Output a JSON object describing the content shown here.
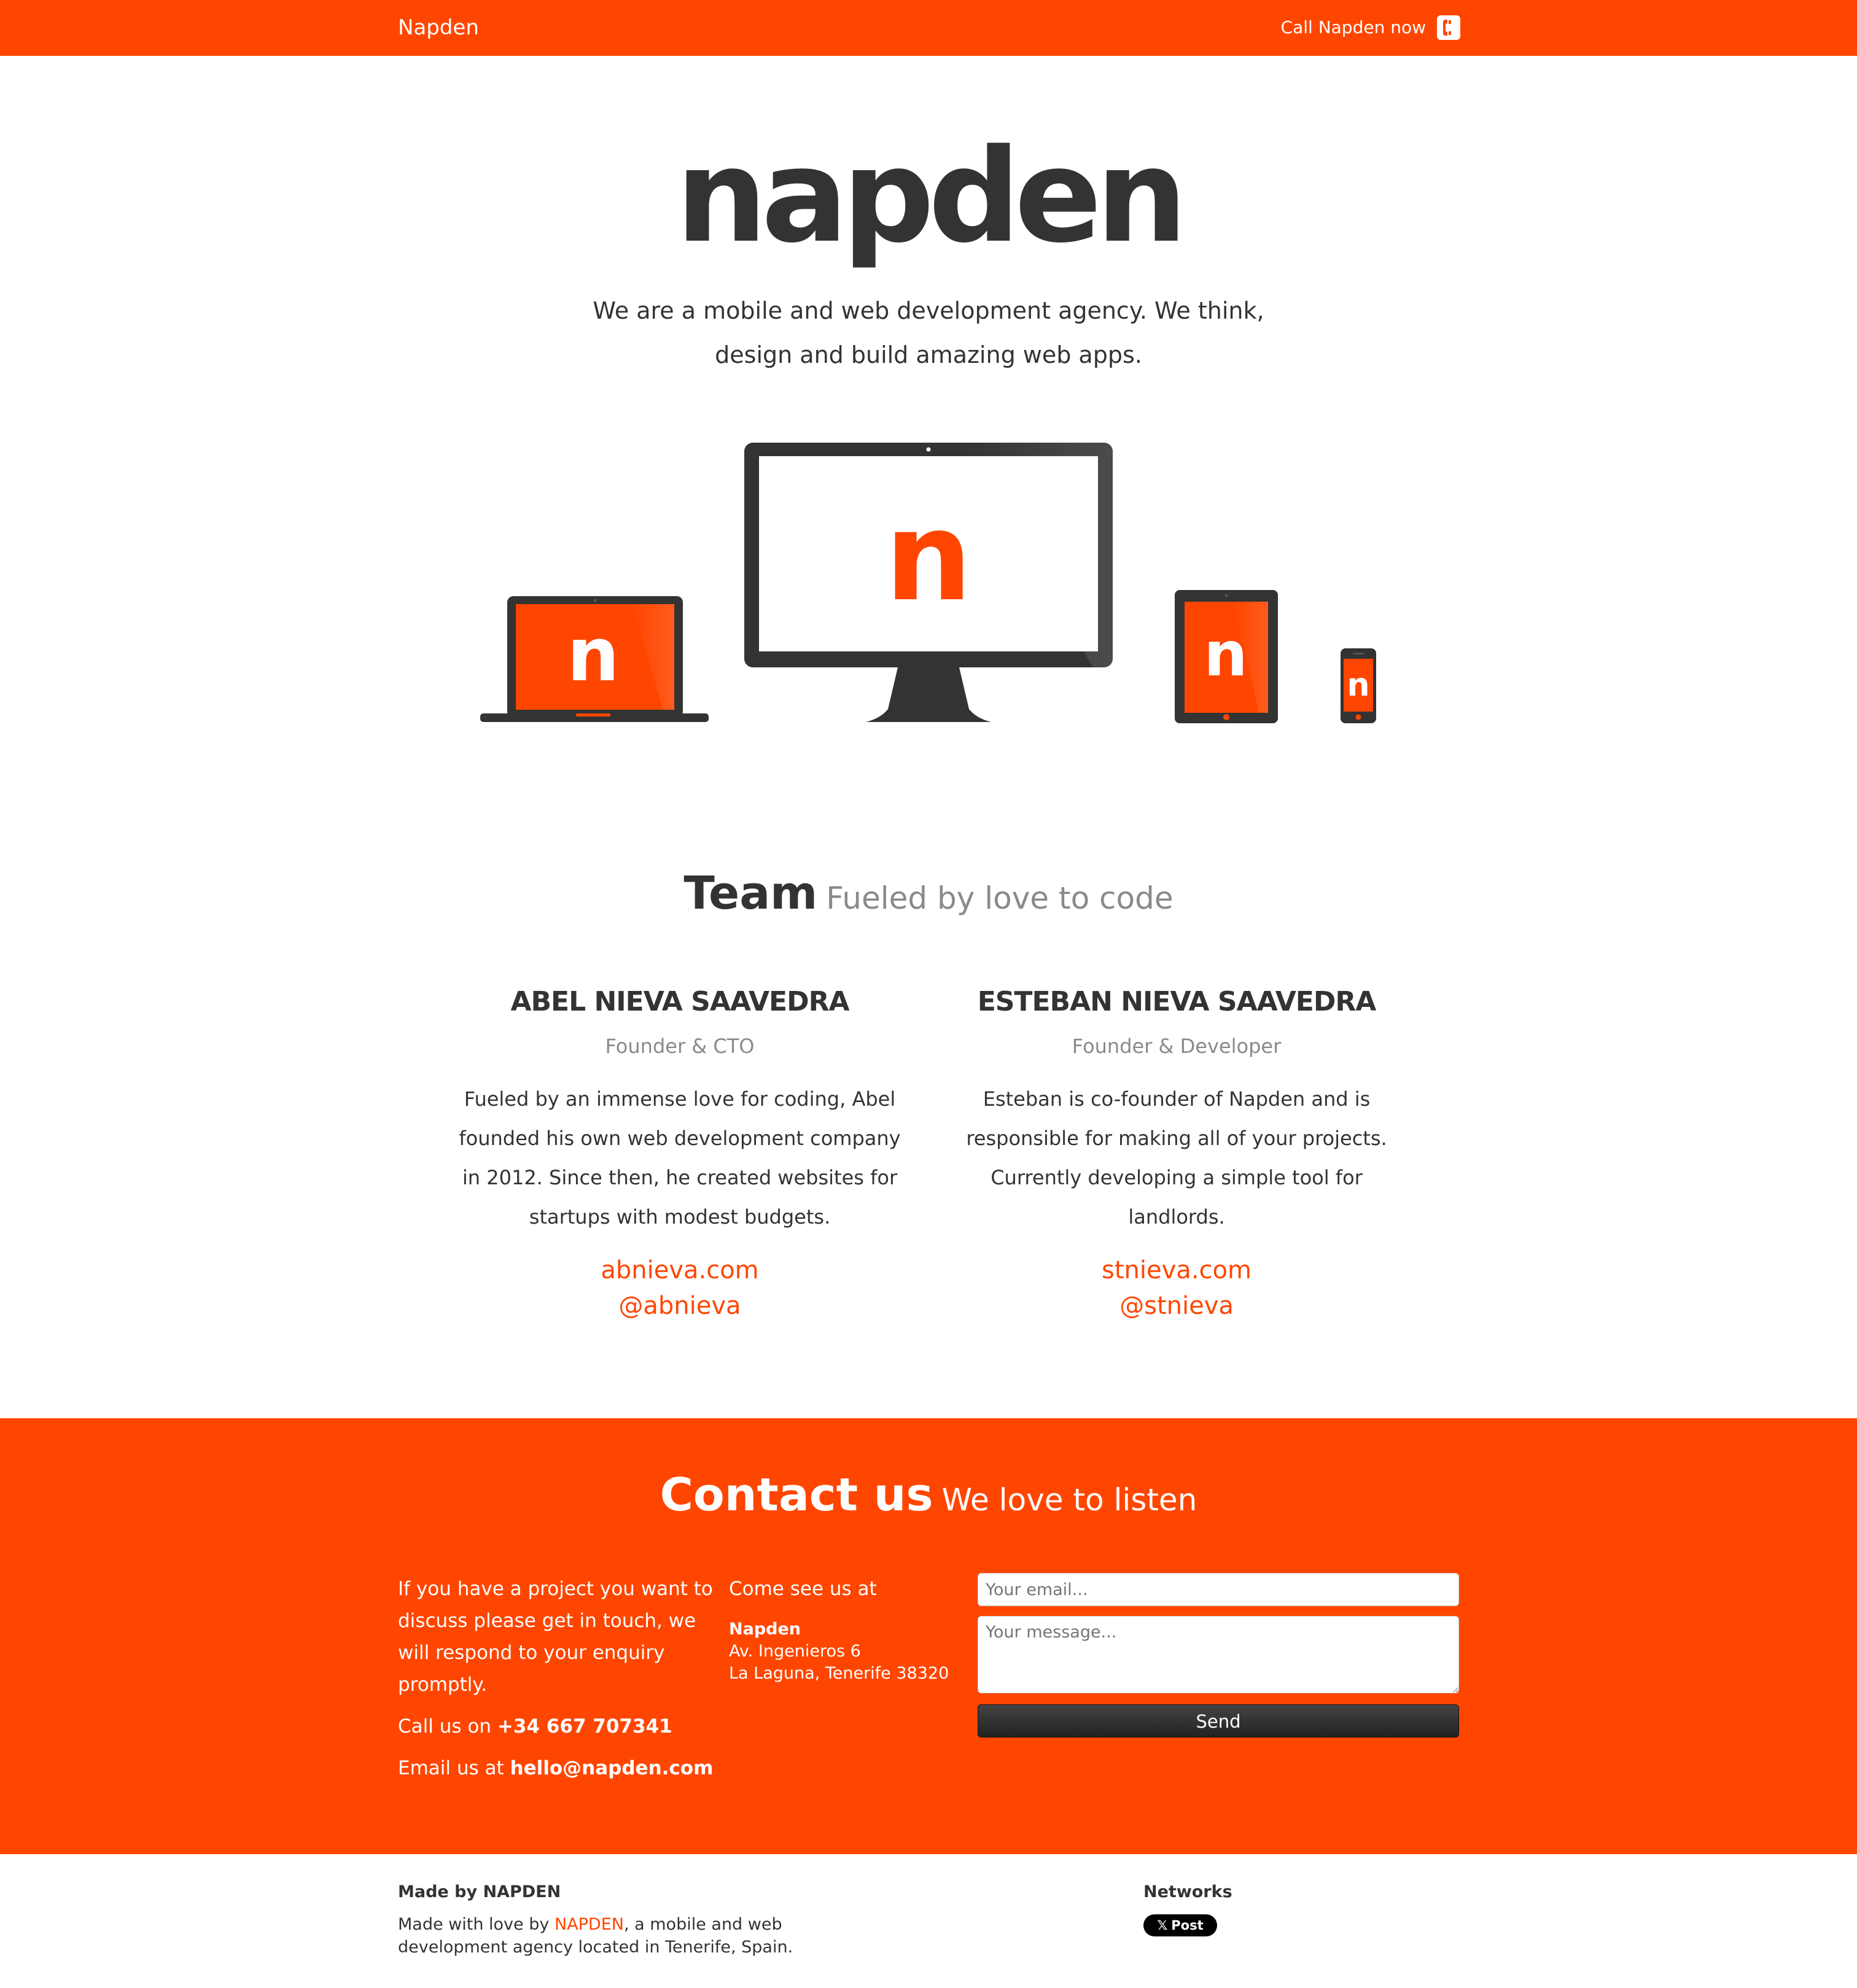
{
  "header": {
    "brand": "Napden",
    "call_label": "Call Napden now",
    "call_icon": "phone-icon"
  },
  "hero": {
    "logo_text": "napden",
    "tagline": "We are a mobile and web development agency. We think, design and build amazing web apps.",
    "device_screen_letter": "n"
  },
  "team": {
    "title": "Team",
    "subtitle": "Fueled by love to code",
    "members": [
      {
        "name": "ABEL NIEVA SAAVEDRA",
        "role": "Founder & CTO",
        "bio": "Fueled by an immense love for coding, Abel founded his own web development company in 2012. Since then, he created websites for startups with modest budgets.",
        "website": "abnieva.com",
        "handle": "@abnieva"
      },
      {
        "name": "ESTEBAN NIEVA SAAVEDRA",
        "role": "Founder & Developer",
        "bio": "Esteban is co-founder of Napden and is responsible for making all of your projects. Currently developing a simple tool for landlords.",
        "website": "stnieva.com",
        "handle": "@stnieva"
      }
    ]
  },
  "contact": {
    "title": "Contact us",
    "subtitle": "We love to listen",
    "intro": "If you have a project you want to discuss please get in touch, we will respond to your enquiry promptly.",
    "call_prefix": "Call us on",
    "phone": "+34 667 707341",
    "email_prefix": "Email us at",
    "email": "hello@napden.com",
    "visit_label": "Come see us at",
    "address_name": "Napden",
    "address_line1": "Av. Ingenieros 6",
    "address_line2": "La Laguna, Tenerife 38320",
    "email_placeholder": "Your email...",
    "message_placeholder": "Your message...",
    "send_label": "Send"
  },
  "footer": {
    "made_by_heading": "Made by NAPDEN",
    "made_with_prefix": "Made with love by",
    "made_with_link": "NAPDEN",
    "made_with_suffix": ", a mobile and web development agency located in Tenerife, Spain.",
    "networks_heading": "Networks",
    "post_button": "Post",
    "post_icon": "x-logo-icon"
  },
  "colors": {
    "brand_orange": "#ff4600",
    "dark": "#333333",
    "muted": "#8a8a8a",
    "white": "#ffffff"
  }
}
